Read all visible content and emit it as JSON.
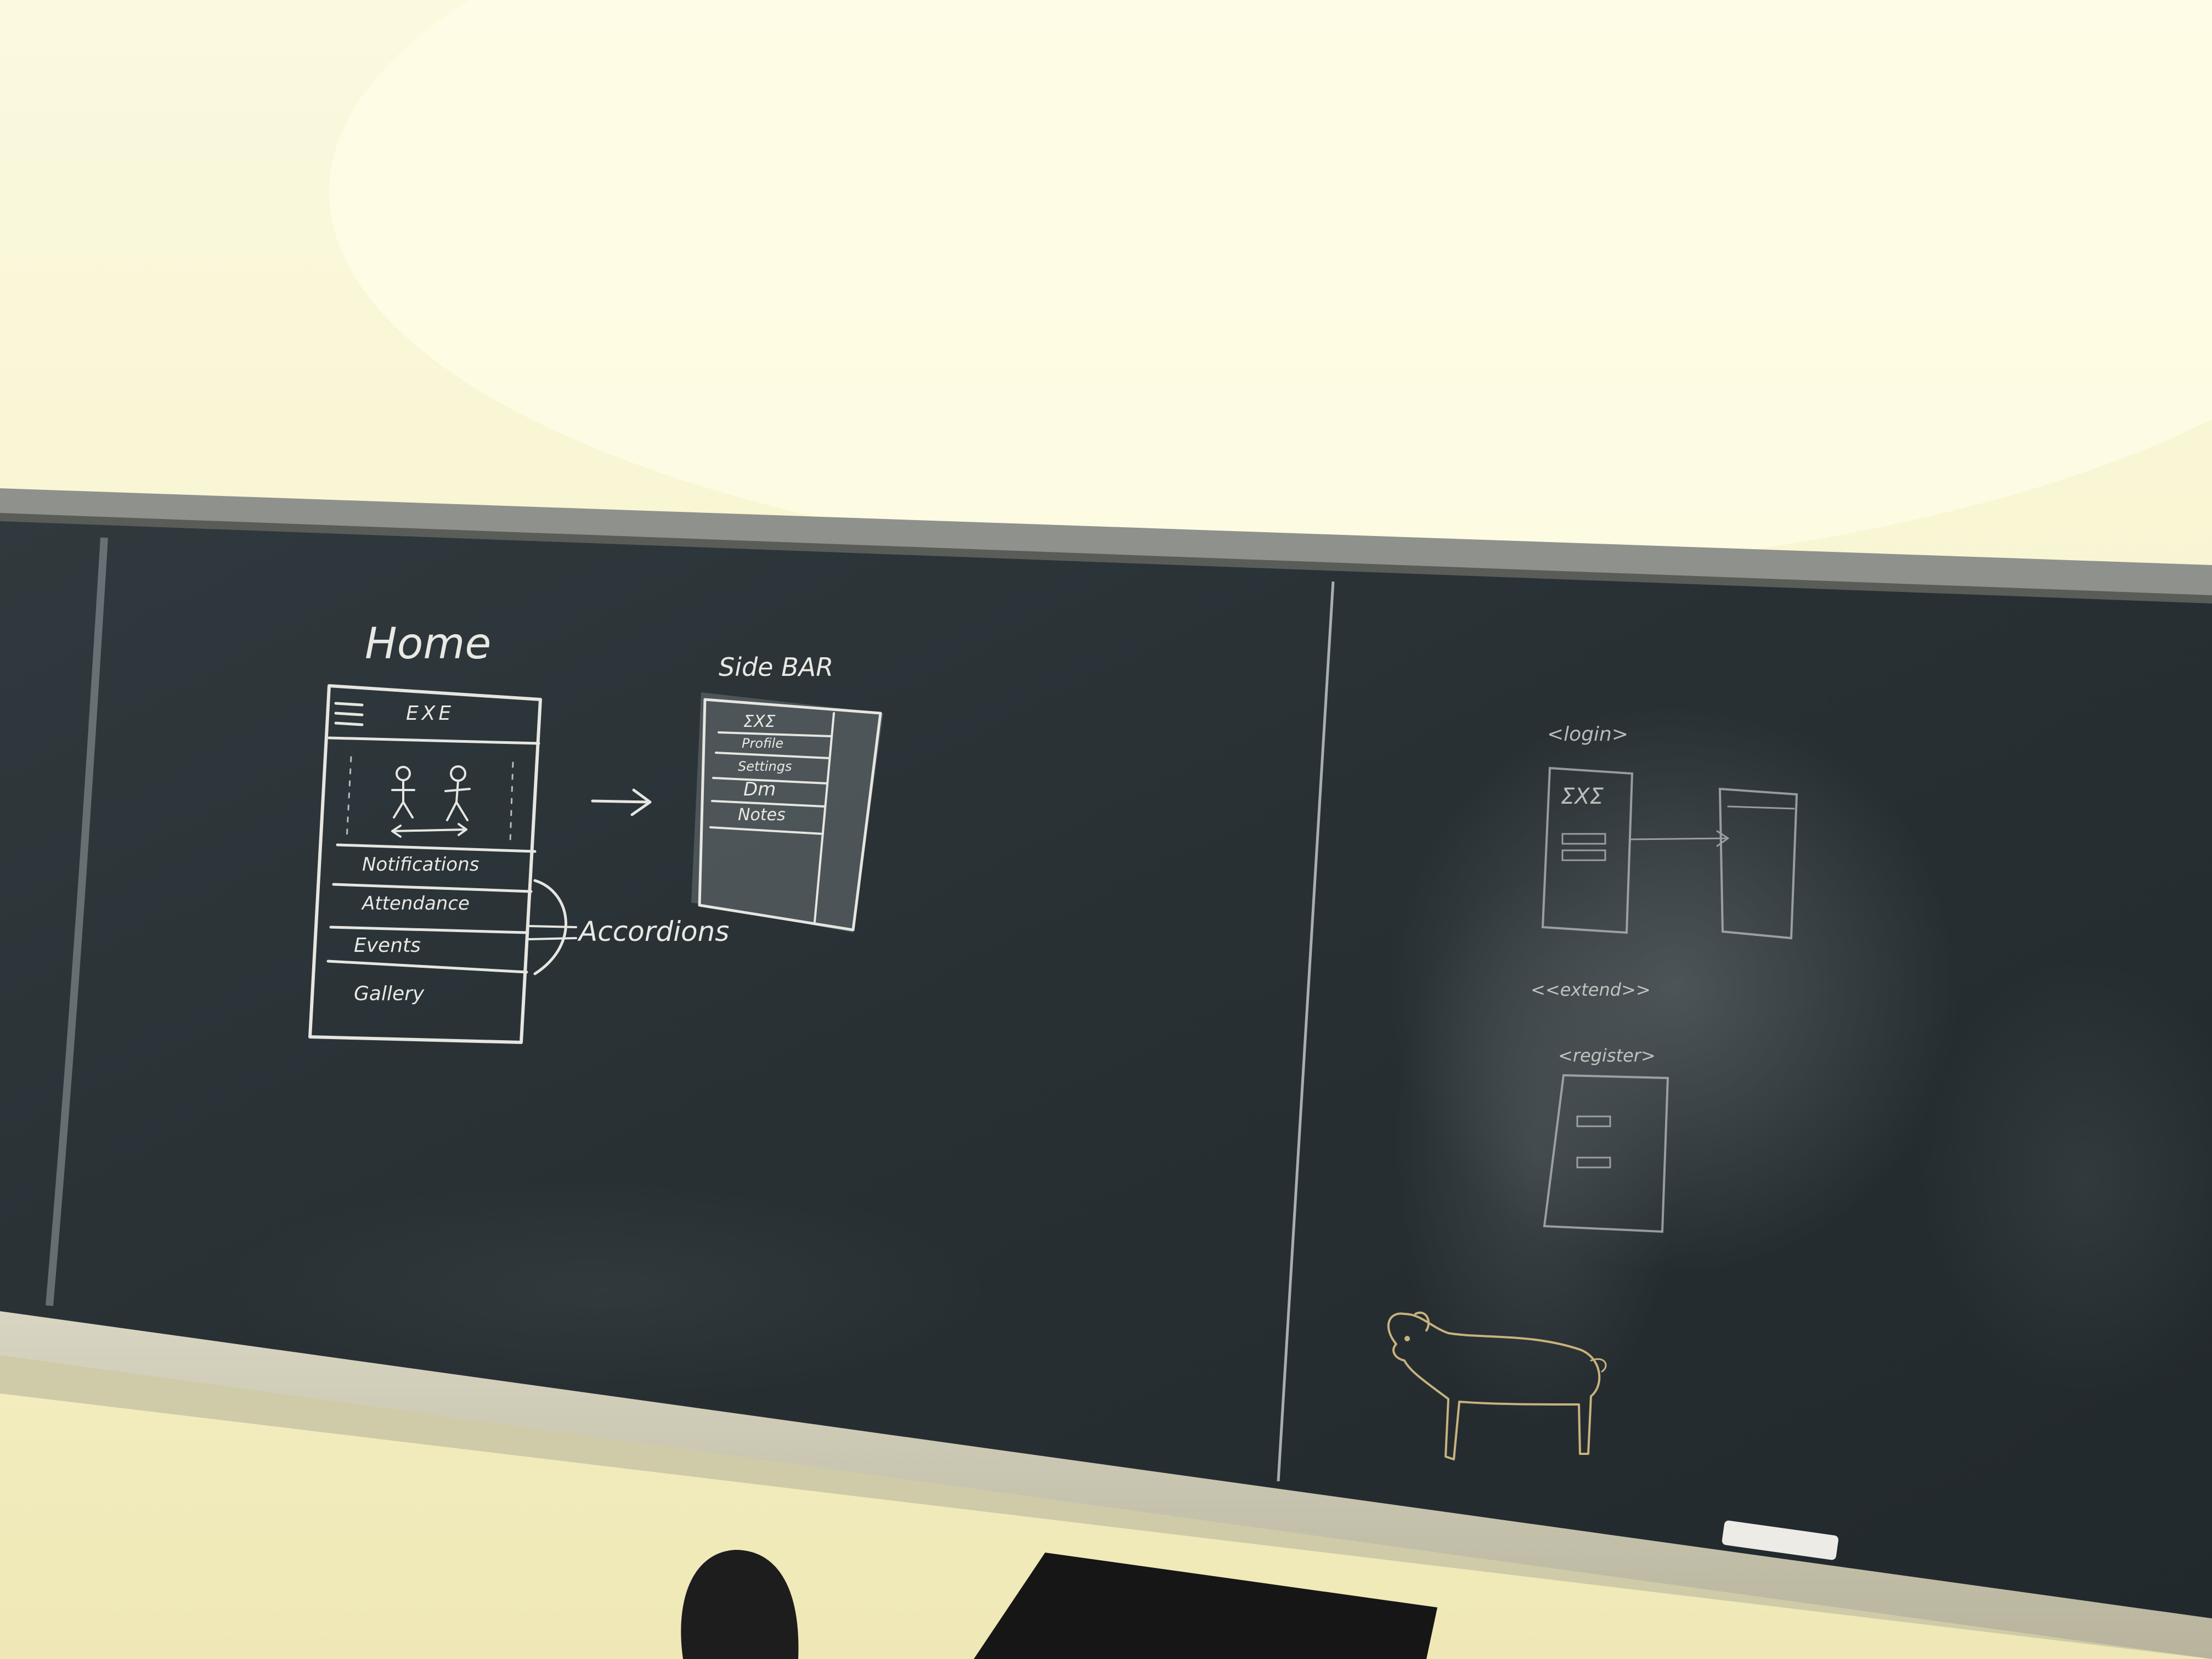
{
  "home_sketch": {
    "title": "Home",
    "header_label": "EXE",
    "items": [
      "Notifications",
      "Attendance",
      "Events",
      "Gallery"
    ],
    "annotation": "Accordions"
  },
  "sidebar_sketch": {
    "title": "Side BAR",
    "items": [
      "ΣXΣ",
      "Profile",
      "Settings",
      "Dm",
      "Notes"
    ]
  },
  "flow_sketch": {
    "login_label": "<login>",
    "screen_label": "ΣXΣ",
    "extend_label": "<<extend>>",
    "register_label": "<register>"
  },
  "colors": {
    "wall": "#f8f5d2",
    "board": "#2c3438",
    "chalk": "#e9e9e4",
    "frame": "#8e8f8a",
    "dog_chalk": "#c9b27c"
  }
}
